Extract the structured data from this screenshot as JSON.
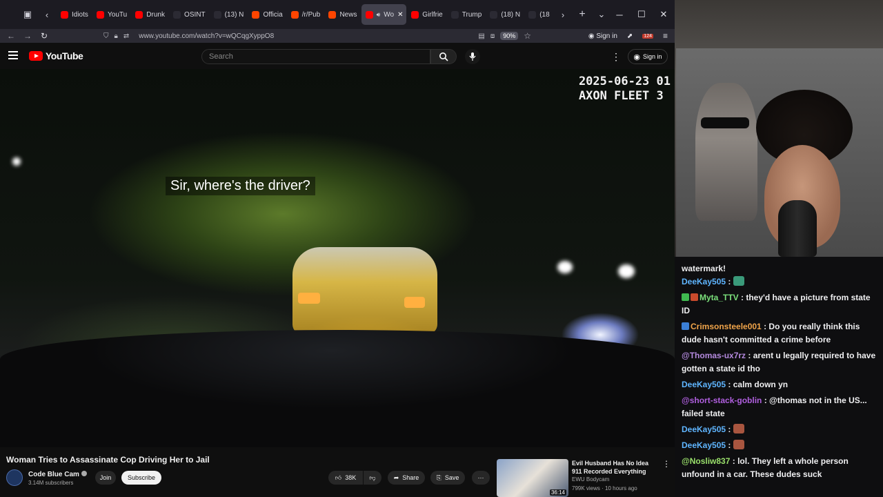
{
  "browser": {
    "tabs": [
      {
        "label": "Idiots",
        "color": "#ff0000"
      },
      {
        "label": "YouTu",
        "color": "#ff0000"
      },
      {
        "label": "Drunk",
        "color": "#ff0000"
      },
      {
        "label": "OSINT",
        "color": "#2b2a33"
      },
      {
        "label": "(13) N",
        "color": "#2b2a33"
      },
      {
        "label": "Officia",
        "color": "#ff4500"
      },
      {
        "label": "/r/Pub",
        "color": "#ff4500"
      },
      {
        "label": "News",
        "color": "#ff4500"
      },
      {
        "label": "Wo",
        "color": "#ff0000"
      },
      {
        "label": "Girlfrie",
        "color": "#ff0000"
      },
      {
        "label": "Trump",
        "color": "#2b2a33"
      },
      {
        "label": "(18) N",
        "color": "#2b2a33"
      },
      {
        "label": "(18",
        "color": "#2b2a33"
      }
    ],
    "url": "www.youtube.com/watch?v=wQCqgXyppO8",
    "zoom": "90%",
    "signin": "Sign in",
    "notification_count": "124"
  },
  "youtube": {
    "logo": "YouTube",
    "search_placeholder": "Search",
    "signin": "Sign in"
  },
  "video": {
    "timestamp": "2025-06-23 01\nAXON FLEET 3",
    "caption": "Sir, where's the driver?",
    "title": "Woman Tries to Assassinate Cop Driving Her to Jail",
    "channel": "Code Blue Cam",
    "subscribers": "3.14M subscribers",
    "join": "Join",
    "subscribe": "Subscribe",
    "likes": "38K",
    "share": "Share",
    "save": "Save"
  },
  "suggestion": {
    "title": "Evil Husband Has No Idea 911 Recorded Everything",
    "channel": "EWU Bodycam",
    "meta": "799K views · 10 hours ago",
    "duration": "36:14"
  },
  "chat": {
    "top_fragment": "watermark!",
    "messages": [
      {
        "user": "DeeKay505",
        "color": "#5fb5ff",
        "text": "",
        "emote": "#3a9a7a"
      },
      {
        "user": "Myta_TTV",
        "color": "#7be07b",
        "text": "they'd have a picture from state ID",
        "badges": [
          "#3fb950",
          "#c94a2c"
        ]
      },
      {
        "user": "Crimsonsteele001",
        "color": "#f0a44a",
        "text": "Do you really think this dude hasn't committed a crime before",
        "badges": [
          "#3b7fd6"
        ]
      },
      {
        "user": "@Thomas-ux7rz",
        "color": "#b58adf",
        "text": "arent u legally required to have gotten a state id tho"
      },
      {
        "user": "DeeKay505",
        "color": "#5fb5ff",
        "text": "calm down yn"
      },
      {
        "user": "@short-stack-goblin",
        "color": "#b05fdf",
        "text": "@thomas not in the US... failed state"
      },
      {
        "user": "DeeKay505",
        "color": "#5fb5ff",
        "text": "",
        "emote": "#a8553f"
      },
      {
        "user": "DeeKay505",
        "color": "#5fb5ff",
        "text": "",
        "emote": "#a8553f"
      },
      {
        "user": "@Nosliw837",
        "color": "#9ae06b",
        "text": "lol. They left a whole person unfound in a car. These dudes suck"
      }
    ]
  }
}
